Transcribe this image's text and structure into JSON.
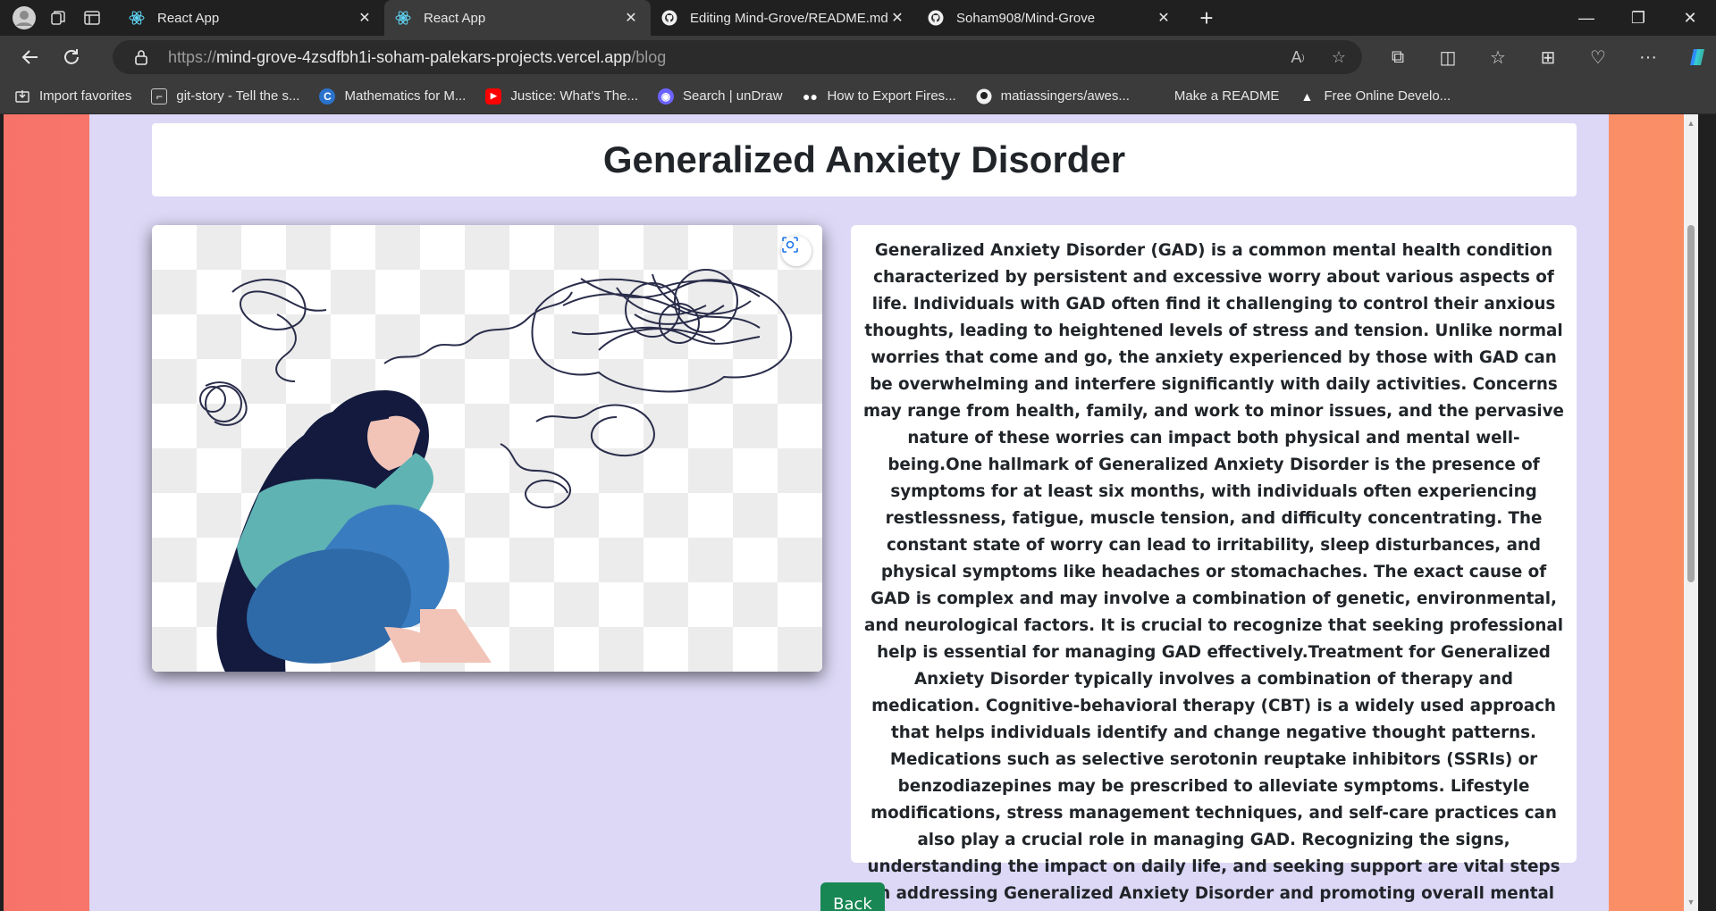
{
  "browser": {
    "tabs": [
      {
        "title": "React App",
        "favicon": "react-icon",
        "active": false
      },
      {
        "title": "React App",
        "favicon": "react-icon",
        "active": true
      },
      {
        "title": "Editing Mind-Grove/README.md",
        "favicon": "github-icon",
        "active": false
      },
      {
        "title": "Soham908/Mind-Grove",
        "favicon": "github-icon",
        "active": false
      }
    ],
    "url": {
      "protocol": "https://",
      "host": "mind-grove-4zsdfbh1i-soham-palekars-projects.vercel.app",
      "path": "/blog"
    },
    "favorites": [
      {
        "label": "Import favorites",
        "icon": "import-icon"
      },
      {
        "label": "git-story - Tell the s...",
        "icon": "git-story-icon"
      },
      {
        "label": "Mathematics for M...",
        "icon": "coursera-icon"
      },
      {
        "label": "Justice: What's The...",
        "icon": "youtube-icon"
      },
      {
        "label": "Search | unDraw",
        "icon": "undraw-icon"
      },
      {
        "label": "How to Export Fires...",
        "icon": "medium-icon"
      },
      {
        "label": "matiassingers/awes...",
        "icon": "github-icon"
      },
      {
        "label": "Make a README",
        "icon": "readme-icon"
      },
      {
        "label": "Free Online Develo...",
        "icon": "dev-tools-icon"
      }
    ]
  },
  "page": {
    "title": "Generalized Anxiety Disorder",
    "body": "Generalized Anxiety Disorder (GAD) is a common mental health condition characterized by persistent and excessive worry about various aspects of life. Individuals with GAD often find it challenging to control their anxious thoughts, leading to heightened levels of stress and tension. Unlike normal worries that come and go, the anxiety experienced by those with GAD can be overwhelming and interfere significantly with daily activities. Concerns may range from health, family, and work to minor issues, and the pervasive nature of these worries can impact both physical and mental well-being.One hallmark of Generalized Anxiety Disorder is the presence of symptoms for at least six months, with individuals often experiencing restlessness, fatigue, muscle tension, and difficulty concentrating. The constant state of worry can lead to irritability, sleep disturbances, and physical symptoms like headaches or stomachaches. The exact cause of GAD is complex and may involve a combination of genetic, environmental, and neurological factors. It is crucial to recognize that seeking professional help is essential for managing GAD effectively.Treatment for Generalized Anxiety Disorder typically involves a combination of therapy and medication. Cognitive-behavioral therapy (CBT) is a widely used approach that helps individuals identify and change negative thought patterns. Medications such as selective serotonin reuptake inhibitors (SSRIs) or benzodiazepines may be prescribed to alleviate symptoms. Lifestyle modifications, stress management techniques, and self-care practices can also play a crucial role in managing GAD. Recognizing the signs, understanding the impact on daily life, and seeking support are vital steps in addressing Generalized Anxiety Disorder and promoting overall mental health.",
    "back_label": "Back",
    "image": "anxious-woman-illustration"
  },
  "colors": {
    "page_gradient_left": "#f7736a",
    "page_gradient_right": "#fa8f66",
    "content_bg": "#dcd8f6",
    "back_button": "#198754"
  }
}
